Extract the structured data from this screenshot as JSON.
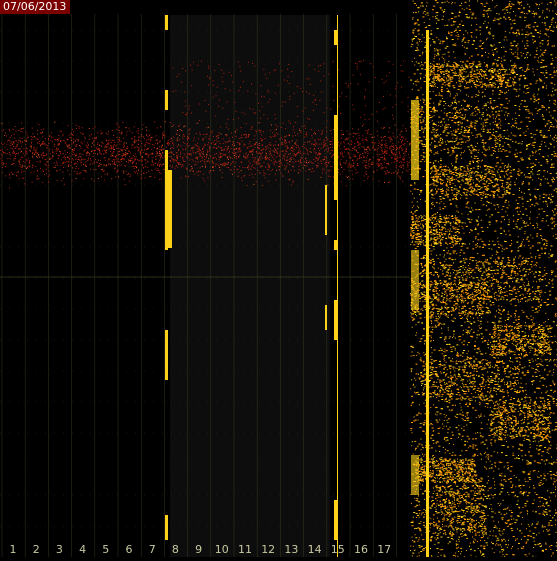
{
  "date_label": "07/06/2013",
  "channel_labels": [
    "1",
    "2",
    "3",
    "4",
    "5",
    "6",
    "7",
    "8",
    "9",
    "10",
    "11",
    "12",
    "13",
    "14",
    "15",
    "16",
    "17"
  ],
  "colors": {
    "background": "#000000",
    "panel_dark": "#0d0d0d",
    "grid": "#3a3a20",
    "signal_bright": "#ffd21a",
    "signal_orange": "#ff9a00",
    "noise_red": "#b02010",
    "date_badge": "#7a0000"
  }
}
